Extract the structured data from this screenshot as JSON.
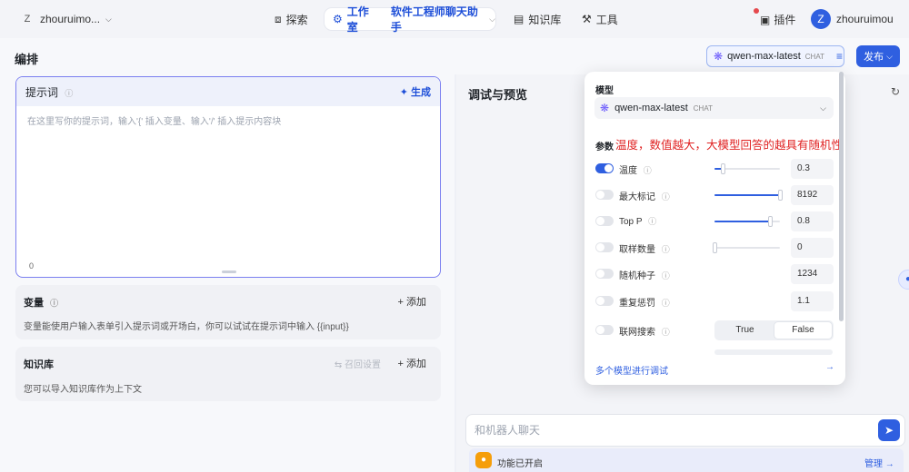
{
  "nav": {
    "workspace_initial": "Z",
    "workspace_name": "zhouruimo...",
    "explore": "探索",
    "studio": "工作室",
    "bot_name": "软件工程师聊天助手",
    "knowledge": "知识库",
    "tools": "工具",
    "plugins": "插件",
    "user_initial": "Z",
    "user_name": "zhouruimou"
  },
  "header": {
    "title": "编排",
    "model_chip": "qwen-max-latest",
    "model_tag": "CHAT",
    "publish": "发布"
  },
  "prompt": {
    "title": "提示词",
    "generate": "生成",
    "placeholder": "在这里写你的提示词，输入'{' 插入变量、输入'/' 插入提示内容块",
    "count": "0"
  },
  "variables": {
    "title": "变量",
    "add": "添加",
    "desc": "变量能使用户输入表单引入提示词或开场白，你可以试试在提示词中输入 {{input}}"
  },
  "knowledge": {
    "title": "知识库",
    "recall": "召回设置",
    "add": "添加",
    "desc": "您可以导入知识库作为上下文"
  },
  "preview": {
    "title": "调试与预览",
    "chat_placeholder": "和机器人聊天",
    "feature_text": "功能已开启",
    "manage": "管理"
  },
  "popup": {
    "model_label": "模型",
    "model_name": "qwen-max-latest",
    "model_tag": "CHAT",
    "params_label": "参数",
    "annotation": "温度，数值越大，大模型回答的越具有随机性",
    "params": [
      {
        "label": "温度",
        "value": "0.3",
        "enabled": true,
        "slider": 0.12
      },
      {
        "label": "最大标记",
        "value": "8192",
        "enabled": false,
        "slider": 1.0
      },
      {
        "label": "Top P",
        "value": "0.8",
        "enabled": false,
        "slider": 0.85
      },
      {
        "label": "取样数量",
        "value": "0",
        "enabled": false,
        "slider": 0.0
      },
      {
        "label": "随机种子",
        "value": "1234",
        "enabled": false
      },
      {
        "label": "重复惩罚",
        "value": "1.1",
        "enabled": false
      }
    ],
    "web_search_label": "联网搜索",
    "web_search_options": [
      "True",
      "False"
    ],
    "web_search_selected": "False",
    "footer": "多个模型进行调试"
  },
  "colors": {
    "accent": "#2f5fe0",
    "annotation": "#e02424"
  }
}
